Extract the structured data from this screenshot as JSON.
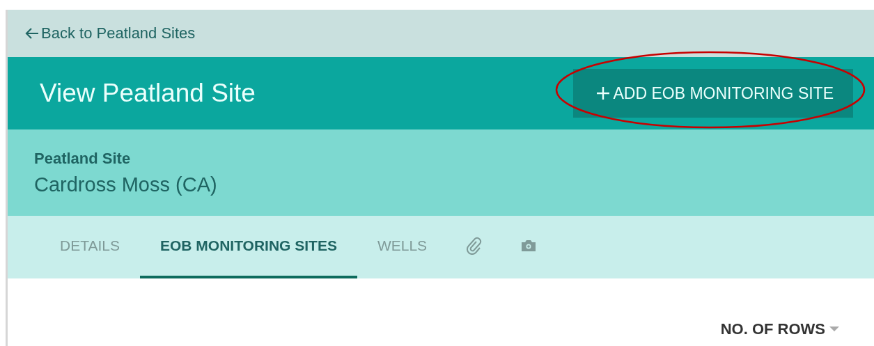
{
  "back_link": {
    "label": "Back to Peatland Sites"
  },
  "header": {
    "title": "View Peatland Site",
    "action_button": {
      "label": "ADD EOB MONITORING SITE",
      "highlighted": true
    }
  },
  "site": {
    "label": "Peatland Site",
    "value": "Cardross Moss (CA)"
  },
  "tabs": [
    {
      "kind": "text",
      "label": "DETAILS",
      "selected": false
    },
    {
      "kind": "text",
      "label": "EOB MONITORING SITES",
      "selected": true
    },
    {
      "kind": "text",
      "label": "WELLS",
      "selected": false
    },
    {
      "kind": "paperclip",
      "selected": false
    },
    {
      "kind": "camera",
      "selected": false
    }
  ],
  "rows_menu": {
    "label": "NO. OF ROWS"
  }
}
